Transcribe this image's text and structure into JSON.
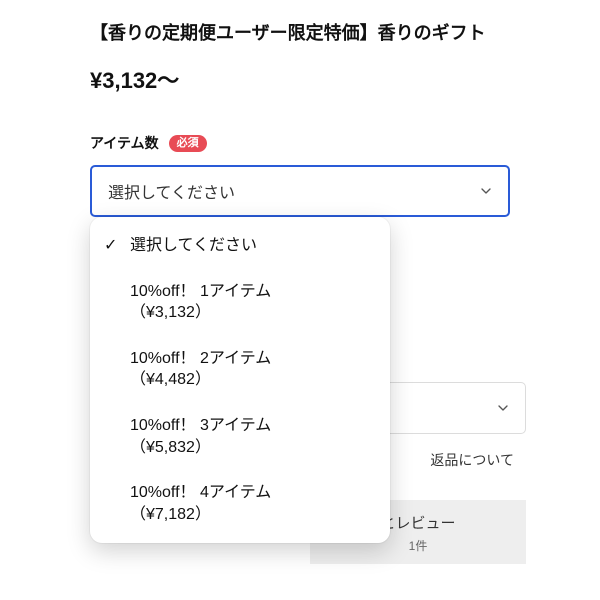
{
  "product": {
    "title": "【香りの定期便ユーザー限定特価】香りのギフト",
    "price": "¥3,132〜"
  },
  "field": {
    "label": "アイテム数",
    "required_badge": "必須",
    "placeholder": "選択してください"
  },
  "options": [
    {
      "line1": "選択してください",
      "line2": "",
      "selected": true
    },
    {
      "line1": "10%off！ 1アイテム",
      "line2": "（¥3,132）",
      "selected": false
    },
    {
      "line1": "10%off！ 2アイテム",
      "line2": "（¥4,482）",
      "selected": false
    },
    {
      "line1": "10%off！ 3アイテム",
      "line2": "（¥5,832）",
      "selected": false
    },
    {
      "line1": "10%off！ 4アイテム",
      "line2": "（¥7,182）",
      "selected": false
    }
  ],
  "links": {
    "returns": "返品について"
  },
  "reviews_tab": {
    "title_suffix": "とレビュー",
    "count": "1件"
  }
}
